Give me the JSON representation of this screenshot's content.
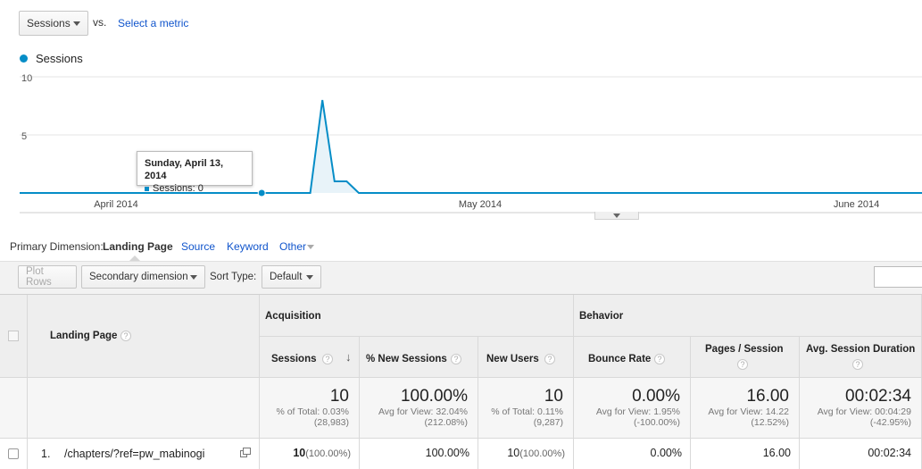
{
  "metric_selector": {
    "selected": "Sessions",
    "vs_label": "vs.",
    "compare_link": "Select a metric"
  },
  "chart_data": {
    "type": "line",
    "series": [
      {
        "name": "Sessions",
        "color": "#058dc7"
      }
    ],
    "y_ticks": [
      "10",
      "5"
    ],
    "ylim": [
      0,
      10
    ],
    "x_labels": [
      "April 2014",
      "May 2014",
      "June 2014"
    ],
    "points": [
      {
        "x": "2014-04-13",
        "y": 0
      },
      {
        "x": "2014-04-14",
        "y": 0
      },
      {
        "x": "2014-04-15",
        "y": 0
      },
      {
        "x": "2014-04-16",
        "y": 0
      },
      {
        "x": "2014-04-17",
        "y": 0
      },
      {
        "x": "2014-04-18",
        "y": 8
      },
      {
        "x": "2014-04-19",
        "y": 1
      },
      {
        "x": "2014-04-20",
        "y": 1
      },
      {
        "x": "2014-04-21",
        "y": 0
      },
      {
        "x": "2014-06-30",
        "y": 0
      }
    ],
    "tooltip": {
      "date": "Sunday, April 13, 2014",
      "label": "Sessions: 0"
    }
  },
  "dimensions": {
    "label": "Primary Dimension:",
    "active": "Landing Page",
    "options": [
      "Source",
      "Keyword",
      "Other"
    ]
  },
  "toolbar": {
    "plot_rows": "Plot Rows",
    "secondary_dimension": "Secondary dimension",
    "sort_type_label": "Sort Type:",
    "sort_type_value": "Default"
  },
  "table": {
    "dim_header": "Landing Page",
    "group_acquisition": "Acquisition",
    "group_behavior": "Behavior",
    "columns": {
      "sessions": "Sessions",
      "new_sessions": "% New Sessions",
      "new_users": "New Users",
      "bounce": "Bounce Rate",
      "pages": "Pages / Session",
      "duration": "Avg. Session Duration"
    },
    "totals": {
      "sessions": {
        "value": "10",
        "sub1": "% of Total: 0.03%",
        "sub2": "(28,983)"
      },
      "new_sessions": {
        "value": "100.00%",
        "sub1": "Avg for View: 32.04%",
        "sub2": "(212.08%)"
      },
      "new_users": {
        "value": "10",
        "sub1": "% of Total: 0.11%",
        "sub2": "(9,287)"
      },
      "bounce": {
        "value": "0.00%",
        "sub1": "Avg for View: 1.95%",
        "sub2": "(-100.00%)"
      },
      "pages": {
        "value": "16.00",
        "sub1": "Avg for View: 14.22",
        "sub2": "(12.52%)"
      },
      "duration": {
        "value": "00:02:34",
        "sub1": "Avg for View: 00:04:29",
        "sub2": "(-42.95%)"
      }
    },
    "rows": [
      {
        "index": "1.",
        "page": "/chapters/?ref=pw_mabinogi",
        "sessions": "10",
        "sessions_pct": "(100.00%)",
        "new_sessions": "100.00%",
        "new_users": "10",
        "new_users_pct": "(100.00%)",
        "bounce": "0.00%",
        "pages": "16.00",
        "duration": "00:02:34"
      }
    ]
  }
}
